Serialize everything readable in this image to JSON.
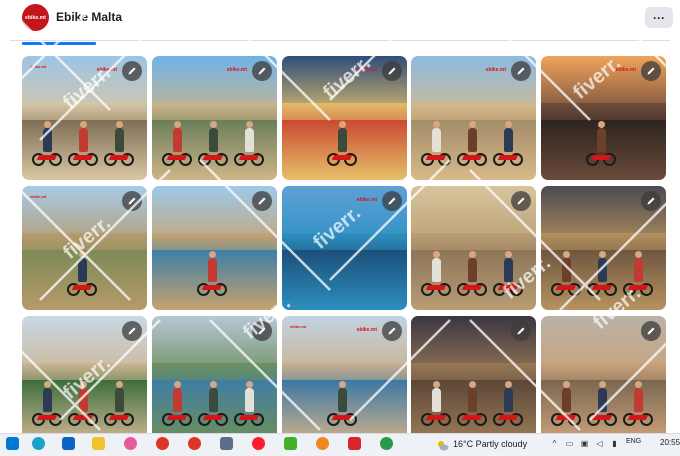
{
  "header": {
    "logo_text": "ebike.mt",
    "title": "Ebike Malta",
    "more_label": "···"
  },
  "photos": [
    {
      "tag": "ebike.mt",
      "brand": "ebike.mt",
      "theme": "coast-group"
    },
    {
      "tag": "",
      "brand": "ebike.mt",
      "theme": "palm-santa-hats"
    },
    {
      "tag": "",
      "brand": "ebike.mt",
      "theme": "santa-christmas"
    },
    {
      "tag": "",
      "brand": "ebike.mt",
      "theme": "village-xmas"
    },
    {
      "tag": "",
      "brand": "ebike.mt",
      "theme": "sunset-cliff"
    },
    {
      "tag": "ebike.mt",
      "brand": "",
      "theme": "countryside"
    },
    {
      "tag": "",
      "brand": "",
      "theme": "cliff-valley"
    },
    {
      "tag": "",
      "brand": "ebike.mt",
      "theme": "blue-lagoon"
    },
    {
      "tag": "",
      "brand": "",
      "theme": "street-group"
    },
    {
      "tag": "",
      "brand": "",
      "theme": "evening-street"
    },
    {
      "tag": "",
      "brand": "",
      "theme": "village-tree"
    },
    {
      "tag": "",
      "brand": "",
      "theme": "coast-winter"
    },
    {
      "tag": "ebike.mt",
      "brand": "ebike.mt",
      "theme": "cliffs"
    },
    {
      "tag": "",
      "brand": "",
      "theme": "night-street"
    },
    {
      "tag": "",
      "brand": "",
      "theme": "lights-street"
    }
  ],
  "watermark": "fiverr.",
  "taskbar": {
    "weather": "16°C  Partly cloudy",
    "language": "ENG",
    "time": "20:55"
  }
}
